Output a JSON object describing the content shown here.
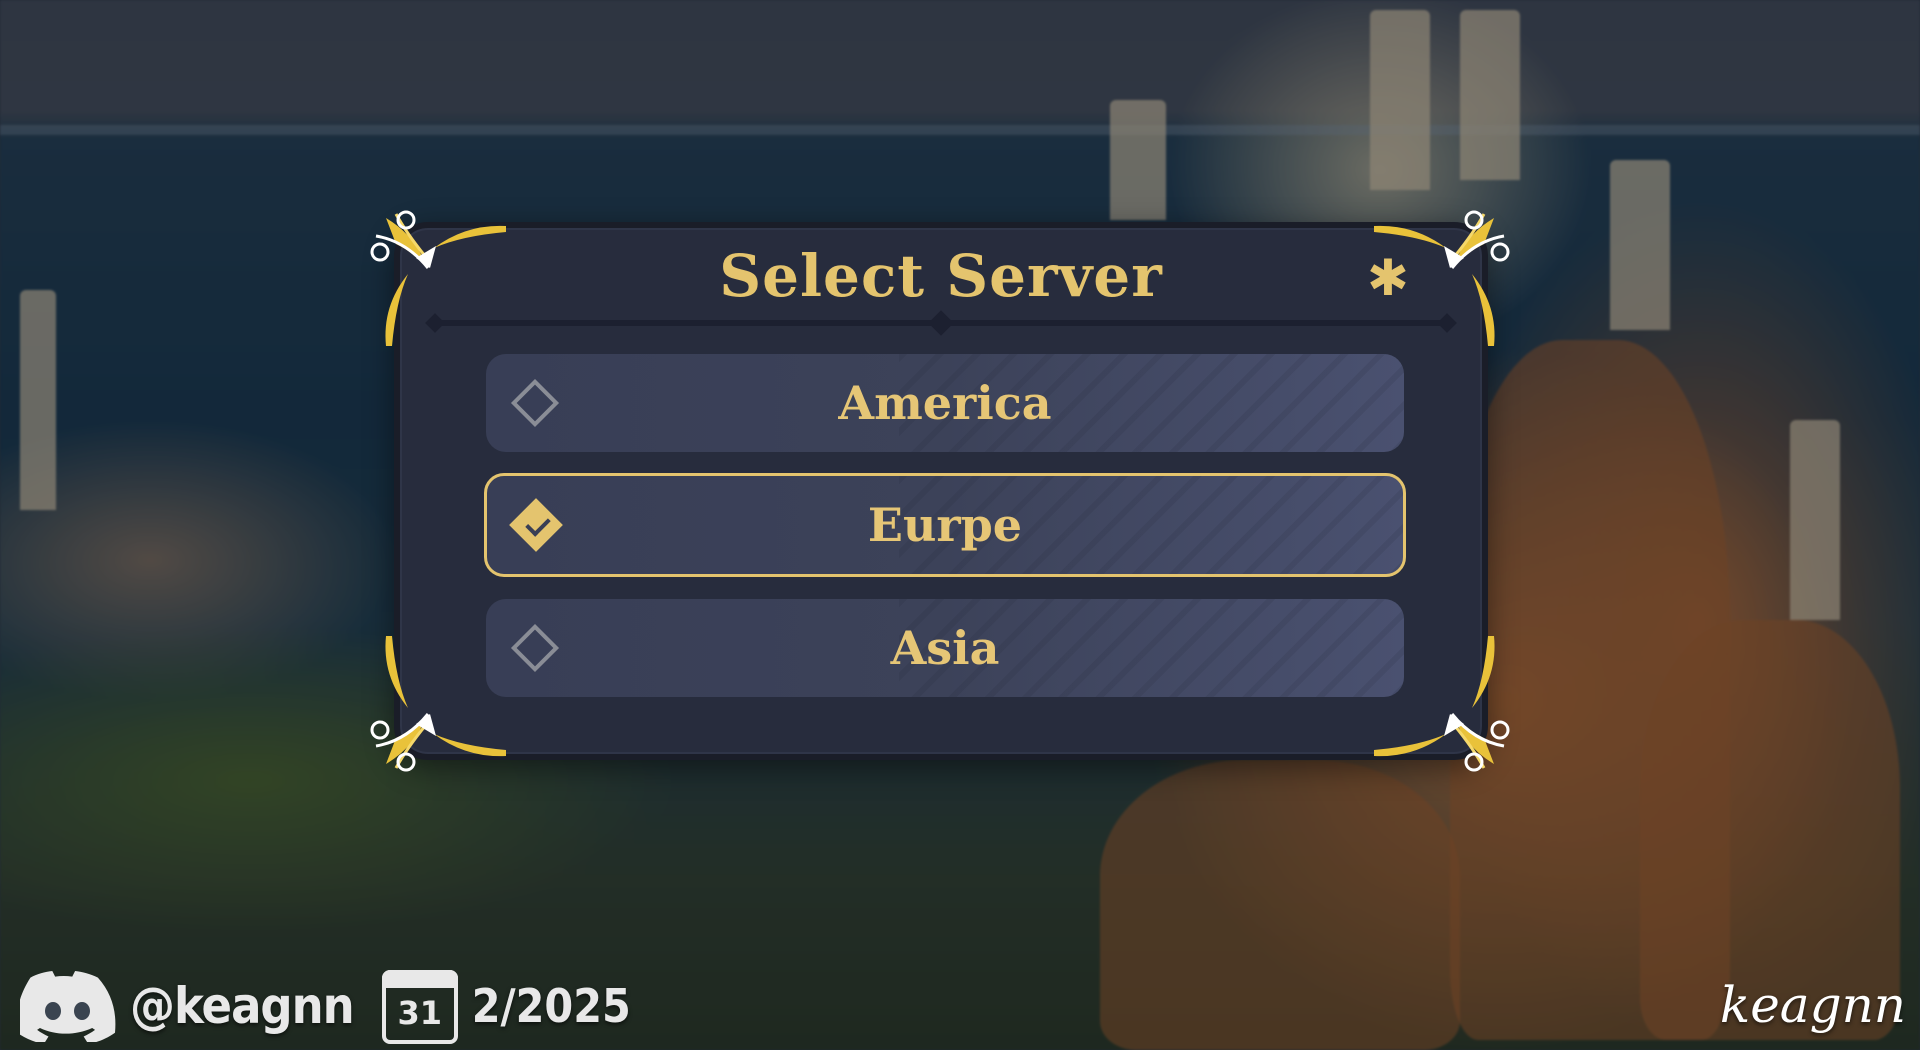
{
  "dialog": {
    "title": "Select Server",
    "close_icon": "close-icon",
    "servers": [
      {
        "label": "America",
        "checked": false
      },
      {
        "label": "Eurpe",
        "checked": true
      },
      {
        "label": "Asia",
        "checked": false
      }
    ]
  },
  "footer": {
    "discord_icon": "discord-icon",
    "handle": "@keagnn",
    "calendar_icon": "calendar-icon",
    "calendar_day": "31",
    "date": "2/2025",
    "signature": "keagnn"
  },
  "colors": {
    "accent_gold": "#e4c46e",
    "panel_bg": "#272c3d",
    "option_bg": "#3c4259",
    "option_border_selected": "#e4c46e"
  }
}
